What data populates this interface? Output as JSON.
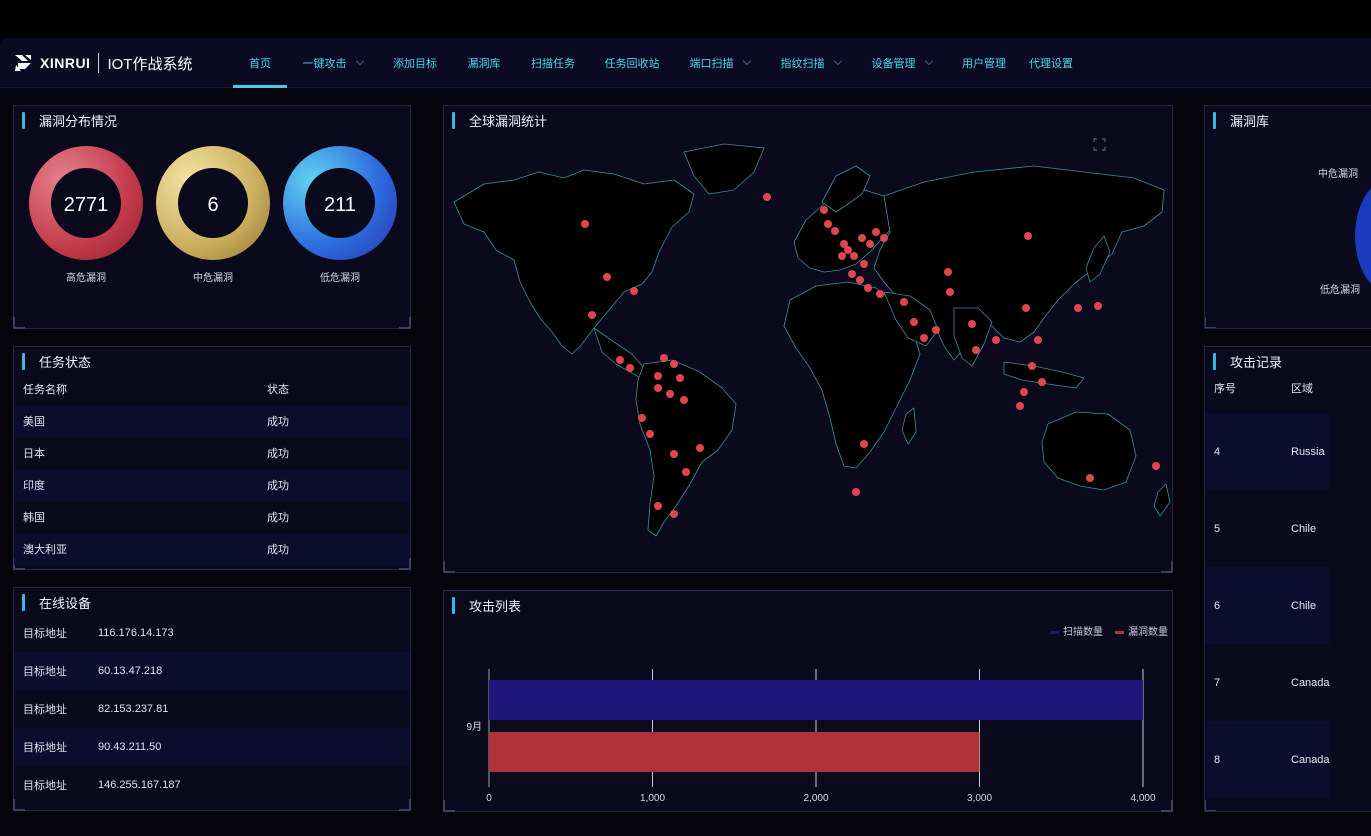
{
  "brand": {
    "word": "XINRUI",
    "title": "IOT作战系统"
  },
  "nav": [
    {
      "label": "首页",
      "dropdown": false,
      "active": true
    },
    {
      "label": "一键攻击",
      "dropdown": true,
      "active": false
    },
    {
      "label": "添加目标",
      "dropdown": false,
      "active": false
    },
    {
      "label": "漏洞库",
      "dropdown": false,
      "active": false
    },
    {
      "label": "扫描任务",
      "dropdown": false,
      "active": false
    },
    {
      "label": "任务回收站",
      "dropdown": false,
      "active": false
    },
    {
      "label": "端口扫描",
      "dropdown": true,
      "active": false
    },
    {
      "label": "指纹扫描",
      "dropdown": true,
      "active": false
    },
    {
      "label": "设备管理",
      "dropdown": true,
      "active": false
    },
    {
      "label": "用户管理",
      "dropdown": false,
      "active": false
    },
    {
      "label": "代理设置",
      "dropdown": false,
      "active": false
    }
  ],
  "vuln_dist": {
    "title": "漏洞分布情况",
    "items": [
      {
        "value": "2771",
        "label": "高危漏洞"
      },
      {
        "value": "6",
        "label": "中危漏洞"
      },
      {
        "value": "211",
        "label": "低危漏洞"
      }
    ]
  },
  "task_status": {
    "title": "任务状态",
    "headers": [
      "任务名称",
      "状态"
    ],
    "rows": [
      [
        "美国",
        "成功"
      ],
      [
        "日本",
        "成功"
      ],
      [
        "印度",
        "成功"
      ],
      [
        "韩国",
        "成功"
      ],
      [
        "澳大利亚",
        "成功"
      ]
    ]
  },
  "online_devices": {
    "title": "在线设备",
    "key_label": "目标地址",
    "ips": [
      "116.176.14.173",
      "60.13.47.218",
      "82.153.237.81",
      "90.43.211.50",
      "146.255.167.187"
    ]
  },
  "global_map": {
    "title": "全球漏洞统计"
  },
  "attack_list": {
    "title": "攻击列表"
  },
  "chart_data": {
    "type": "bar",
    "orientation": "horizontal",
    "categories": [
      "9月"
    ],
    "series": [
      {
        "name": "扫描数量",
        "values": [
          4000
        ],
        "color": "#1f157a"
      },
      {
        "name": "漏洞数量",
        "values": [
          3000
        ],
        "color": "#b1323c"
      }
    ],
    "xlim": [
      0,
      4000
    ],
    "xticks": [
      "0",
      "1,000",
      "2,000",
      "3,000",
      "4,000"
    ],
    "legend": "top-right"
  },
  "vuln_lib": {
    "title": "漏洞库",
    "labels": [
      "中危漏洞",
      "低危漏洞"
    ]
  },
  "attack_records": {
    "title": "攻击记录",
    "headers": [
      "序号",
      "区域"
    ],
    "rows": [
      [
        "4",
        "Russia"
      ],
      [
        "5",
        "Chile"
      ],
      [
        "6",
        "Chile"
      ],
      [
        "7",
        "Canada"
      ],
      [
        "8",
        "Canada"
      ]
    ]
  },
  "colors": {
    "accent": "#3fd0e3",
    "high": "#c0404e",
    "mid": "#c9ad5c",
    "low": "#2f6fe0",
    "dot": "#e0464e"
  }
}
